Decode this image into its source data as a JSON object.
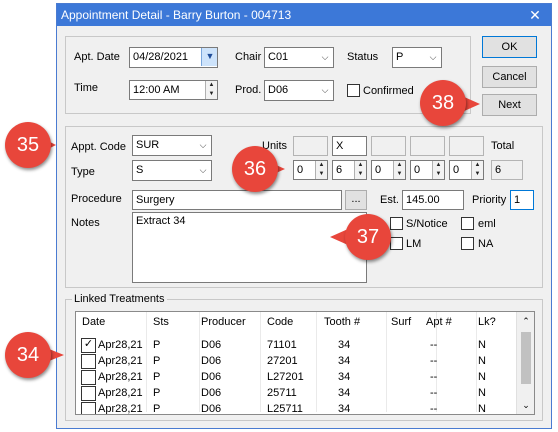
{
  "window": {
    "title": "Appointment Detail - Barry Burton - 004713",
    "close_glyph": "✕"
  },
  "top": {
    "apt_date_label": "Apt. Date",
    "apt_date_value": "04/28/2021",
    "time_label": "Time",
    "time_value": "12:00 AM",
    "chair_label": "Chair",
    "chair_value": "C01",
    "prod_label": "Prod.",
    "prod_value": "D06",
    "status_label": "Status",
    "status_value": "P",
    "confirmed_label": "Confirmed"
  },
  "buttons": {
    "ok": "OK",
    "cancel": "Cancel",
    "next": "Next"
  },
  "details": {
    "appt_code_label": "Appt. Code",
    "appt_code_value": "SUR",
    "type_label": "Type",
    "type_value": "S",
    "units_label": "Units",
    "units_top": [
      "",
      "X",
      "",
      "",
      ""
    ],
    "units_values": [
      "0",
      "6",
      "0",
      "0",
      "0"
    ],
    "total_label": "Total",
    "total_value": "6",
    "procedure_label": "Procedure",
    "procedure_value": "Surgery",
    "ellipsis": "...",
    "est_label": "Est.",
    "est_value": "145.00",
    "priority_label": "Priority",
    "priority_value": "1",
    "notes_label": "Notes",
    "notes_value": "Extract 34",
    "flags": [
      {
        "label": "S/Notice"
      },
      {
        "label": "eml"
      },
      {
        "label": "LM"
      },
      {
        "label": "NA"
      }
    ]
  },
  "linked": {
    "title": "Linked Treatments",
    "columns": [
      "Date",
      "Sts",
      "Producer",
      "Code",
      "Tooth #",
      "Surf",
      "Apt #",
      "Lk?"
    ],
    "rows": [
      {
        "checked": true,
        "date": "Apr28,21",
        "sts": "P",
        "producer": "D06",
        "code": "71101",
        "tooth": "34",
        "surf": "",
        "apt": "--",
        "lk": "N"
      },
      {
        "checked": false,
        "date": "Apr28,21",
        "sts": "P",
        "producer": "D06",
        "code": "27201",
        "tooth": "34",
        "surf": "",
        "apt": "--",
        "lk": "N"
      },
      {
        "checked": false,
        "date": "Apr28,21",
        "sts": "P",
        "producer": "D06",
        "code": "L27201",
        "tooth": "34",
        "surf": "",
        "apt": "--",
        "lk": "N"
      },
      {
        "checked": false,
        "date": "Apr28,21",
        "sts": "P",
        "producer": "D06",
        "code": "25711",
        "tooth": "34",
        "surf": "",
        "apt": "--",
        "lk": "N"
      },
      {
        "checked": false,
        "date": "Apr28,21",
        "sts": "P",
        "producer": "D06",
        "code": "L25711",
        "tooth": "34",
        "surf": "",
        "apt": "--",
        "lk": "N"
      }
    ]
  },
  "callouts": {
    "c34": "34",
    "c35": "35",
    "c36": "36",
    "c37": "37",
    "c38": "38"
  },
  "colors": {
    "callout": "#e8463b",
    "titlebar": "#3c78d8"
  },
  "icons": {
    "dropdown": "chevron-down-icon",
    "check": "checkmark-icon"
  }
}
